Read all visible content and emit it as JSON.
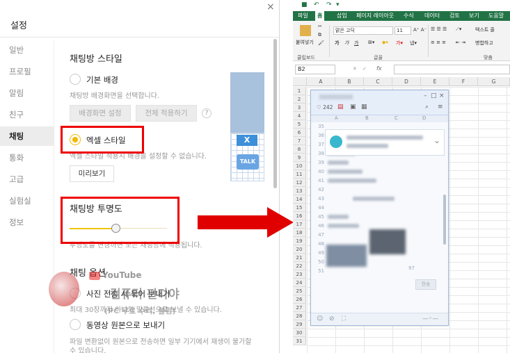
{
  "settings": {
    "title": "설정",
    "close": "×",
    "nav": [
      "일반",
      "프로필",
      "알림",
      "친구",
      "채팅",
      "통화",
      "고급",
      "실험실",
      "정보"
    ],
    "active_nav": "채팅",
    "style_section": "채팅방 스타일",
    "basic_bg_label": "기본 배경",
    "basic_bg_desc": "채팅방 배경화면을 선택합니다.",
    "bg_settings_btn": "배경화면 설정",
    "apply_all_btn": "전체 적용하기",
    "help": "?",
    "excel_style_label": "엑셀 스타일",
    "excel_style_desc": "엑셀 스타일 적용시 배경을 설정할 수 없습니다.",
    "preview_btn": "미리보기",
    "preview_excel_x": "X",
    "preview_excel_talk": "TALK",
    "transparency_section": "채팅방 투명도",
    "transparency_desc": "투명도를 변경하면 모든 채팅방에 적용됩니다.",
    "transparency_value": 0.47,
    "options_section": "채팅 옵션",
    "photo_bundle_label": "사진 전송 시 묶어 보내기",
    "photo_bundle_desc": "최대 30장까지 하나의 말풍선으로 보낼 수 있습니다.",
    "video_original_label": "동영상 원본으로 보내기",
    "video_original_desc_1": "파일 변환없이 원본으로 전송하면 일부 기기에서 재생이 불가할",
    "video_original_desc_2": "수 있습니다."
  },
  "watermark": {
    "brand": "YouTube",
    "logo_text": "PC",
    "main": "컴퓨터 판다야",
    "sub": "(PC 무료 수리, 불펌)"
  },
  "excel": {
    "tabs": [
      "파일",
      "홈",
      "삽입",
      "페이지 레이아웃",
      "수식",
      "데이터",
      "검토",
      "보기",
      "도움말"
    ],
    "active_tab": "홈",
    "paste_label": "붙여넣기",
    "font_name": "맑은 고딕",
    "font_size": "11",
    "wrap_text": "텍스트 줄",
    "merge_center": "병합하고",
    "group_clipboard": "클립보드",
    "group_font": "글꼴",
    "group_align": "맞춤",
    "name_box": "B2",
    "fx": "fx",
    "columns": [
      "A",
      "B",
      "C",
      "D",
      "E",
      "F",
      "G"
    ],
    "rows": [
      "1",
      "2",
      "3",
      "4",
      "5",
      "6",
      "7",
      "8",
      "9",
      "10",
      "11",
      "12",
      "13",
      "14",
      "15",
      "16",
      "17",
      "18",
      "19",
      "20",
      "21",
      "22",
      "23",
      "24",
      "25",
      "26",
      "27",
      "28",
      "29",
      "30",
      "31"
    ],
    "chat": {
      "count": "242",
      "col_labels": [
        "A",
        "B",
        "C",
        "D"
      ],
      "row_nums": [
        "35",
        "36",
        "37",
        "38",
        "39",
        "40",
        "41",
        "42",
        "43",
        "44",
        "45",
        "46",
        "47",
        "48",
        "49",
        "50",
        "51"
      ],
      "send": "전송",
      "time": "97"
    }
  },
  "colors": {
    "accent_yellow": "#f5b800",
    "excel_green": "#217346",
    "highlight_red": "#e00000"
  }
}
